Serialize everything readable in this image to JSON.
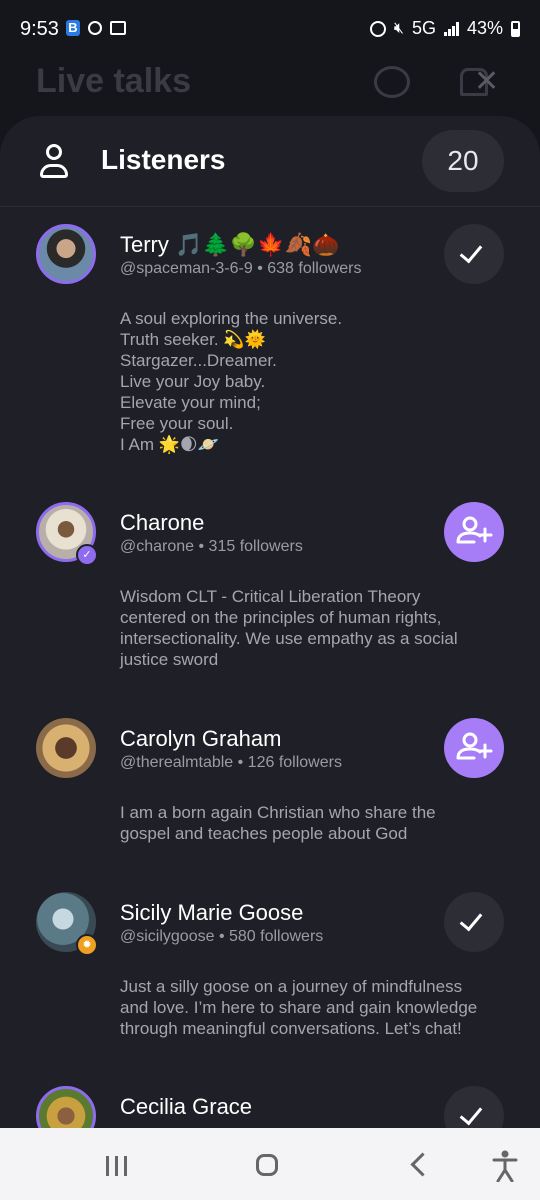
{
  "status_bar": {
    "time": "9:53",
    "network": "5G",
    "battery": "43%"
  },
  "background_screen": {
    "title": "Live talks"
  },
  "sheet": {
    "title": "Listeners",
    "count": "20"
  },
  "listeners": [
    {
      "name": "Terry 🎵🌲🌳🍁🍂🌰",
      "meta": "@spaceman-3-6-9 • 638 followers",
      "bio": "A soul exploring the universe.\nTruth seeker. 💫🌞\nStargazer...Dreamer.\nLive your Joy baby.\nElevate your mind;\nFree your soul.\nI Am  🌟🌒🪐",
      "state": "following"
    },
    {
      "name": "Charone",
      "meta": "@charone • 315 followers",
      "bio": "Wisdom CLT - Critical Liberation Theory\ncentered on the principles of human rights,\nintersectionality. We use  empathy as a social\njustice sword",
      "state": "follow"
    },
    {
      "name": "Carolyn Graham",
      "meta": "@therealmtable • 126 followers",
      "bio": "I am a born again Christian who share the\ngospel and teaches people about God",
      "state": "follow"
    },
    {
      "name": "Sicily Marie Goose",
      "meta": "@sicilygoose • 580 followers",
      "bio": "Just a silly goose on a journey of mindfulness\nand love. I’m here to share and gain knowledge\nthrough meaningful conversations. Let’s chat!",
      "state": "following"
    },
    {
      "name": "Cecilia Grace",
      "meta": "",
      "bio": "",
      "state": "following"
    }
  ],
  "colors": {
    "sheet_bg": "#1f2027",
    "accent_purple": "#a67cf7",
    "verified_purple": "#8f6bf0",
    "verified_gold": "#f0a020"
  },
  "icons": {
    "header": "person-icon",
    "following": "check-icon",
    "follow": "add-user-icon"
  }
}
